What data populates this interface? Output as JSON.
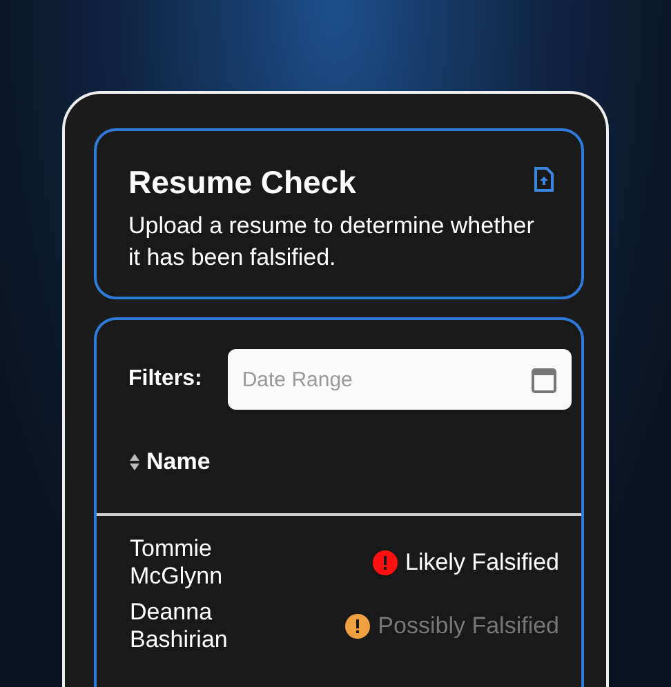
{
  "header": {
    "title": "Resume Check",
    "description": "Upload a resume to determine whether it has been falsified."
  },
  "filters": {
    "label": "Filters:",
    "date_field": {
      "placeholder": "Date Range"
    }
  },
  "table": {
    "columns": [
      {
        "label": "Name"
      }
    ],
    "rows": [
      {
        "name": "Tommie McGlynn",
        "status": "Likely Falsified",
        "kind": "likely",
        "color": "#ff1010"
      },
      {
        "name": "Deanna Bashirian",
        "status": "Possibly Falsified",
        "kind": "possibly",
        "color": "#f0a040"
      }
    ]
  }
}
